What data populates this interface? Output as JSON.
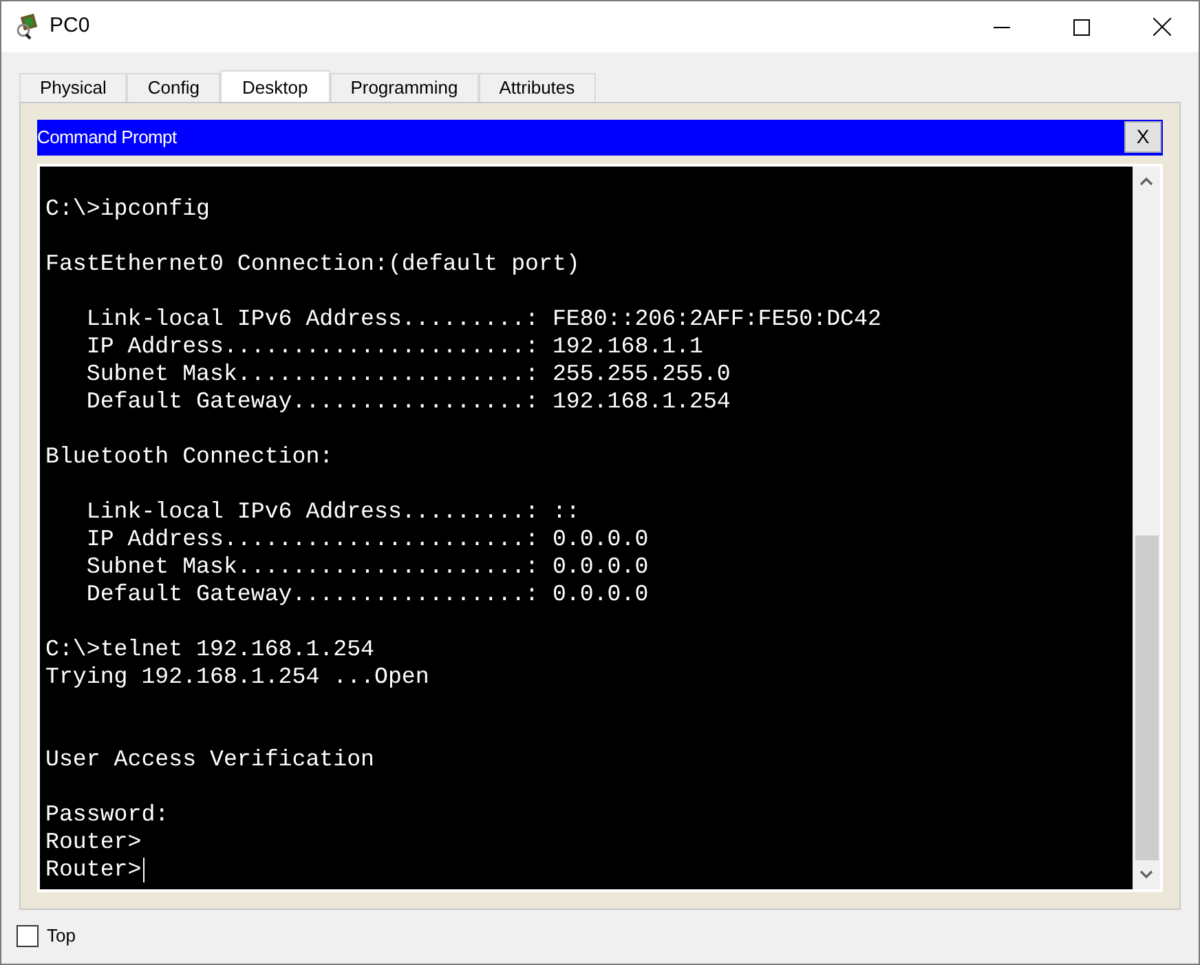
{
  "window": {
    "title": "PC0"
  },
  "tabs": [
    {
      "label": "Physical",
      "selected": false
    },
    {
      "label": "Config",
      "selected": false
    },
    {
      "label": "Desktop",
      "selected": true
    },
    {
      "label": "Programming",
      "selected": false
    },
    {
      "label": "Attributes",
      "selected": false
    }
  ],
  "panel": {
    "title": "Command Prompt",
    "close_label": "X"
  },
  "terminal": {
    "lines": [
      {
        "kind": "blank"
      },
      {
        "kind": "text",
        "text": "C:\\>ipconfig",
        "cursor": false
      },
      {
        "kind": "blank"
      },
      {
        "kind": "text",
        "text": "FastEthernet0 Connection:(default port)",
        "cursor": false
      },
      {
        "kind": "blank"
      },
      {
        "kind": "text",
        "text": "   Link-local IPv6 Address.........: FE80::206:2AFF:FE50:DC42",
        "cursor": false
      },
      {
        "kind": "text",
        "text": "   IP Address......................: 192.168.1.1",
        "cursor": false
      },
      {
        "kind": "text",
        "text": "   Subnet Mask.....................: 255.255.255.0",
        "cursor": false
      },
      {
        "kind": "text",
        "text": "   Default Gateway.................: 192.168.1.254",
        "cursor": false
      },
      {
        "kind": "blank"
      },
      {
        "kind": "text",
        "text": "Bluetooth Connection:",
        "cursor": false
      },
      {
        "kind": "blank"
      },
      {
        "kind": "text",
        "text": "   Link-local IPv6 Address.........: ::",
        "cursor": false
      },
      {
        "kind": "text",
        "text": "   IP Address......................: 0.0.0.0",
        "cursor": false
      },
      {
        "kind": "text",
        "text": "   Subnet Mask.....................: 0.0.0.0",
        "cursor": false
      },
      {
        "kind": "text",
        "text": "   Default Gateway.................: 0.0.0.0",
        "cursor": false
      },
      {
        "kind": "blank"
      },
      {
        "kind": "text",
        "text": "C:\\>telnet 192.168.1.254",
        "cursor": false
      },
      {
        "kind": "text",
        "text": "Trying 192.168.1.254 ...Open",
        "cursor": false
      },
      {
        "kind": "blank"
      },
      {
        "kind": "blank"
      },
      {
        "kind": "text",
        "text": "User Access Verification",
        "cursor": false
      },
      {
        "kind": "blank"
      },
      {
        "kind": "text",
        "text": "Password:",
        "cursor": false
      },
      {
        "kind": "text",
        "text": "Router>",
        "cursor": false
      },
      {
        "kind": "text",
        "text": "Router>",
        "cursor": true
      }
    ]
  },
  "top_checkbox": {
    "label": "Top",
    "checked": false
  }
}
